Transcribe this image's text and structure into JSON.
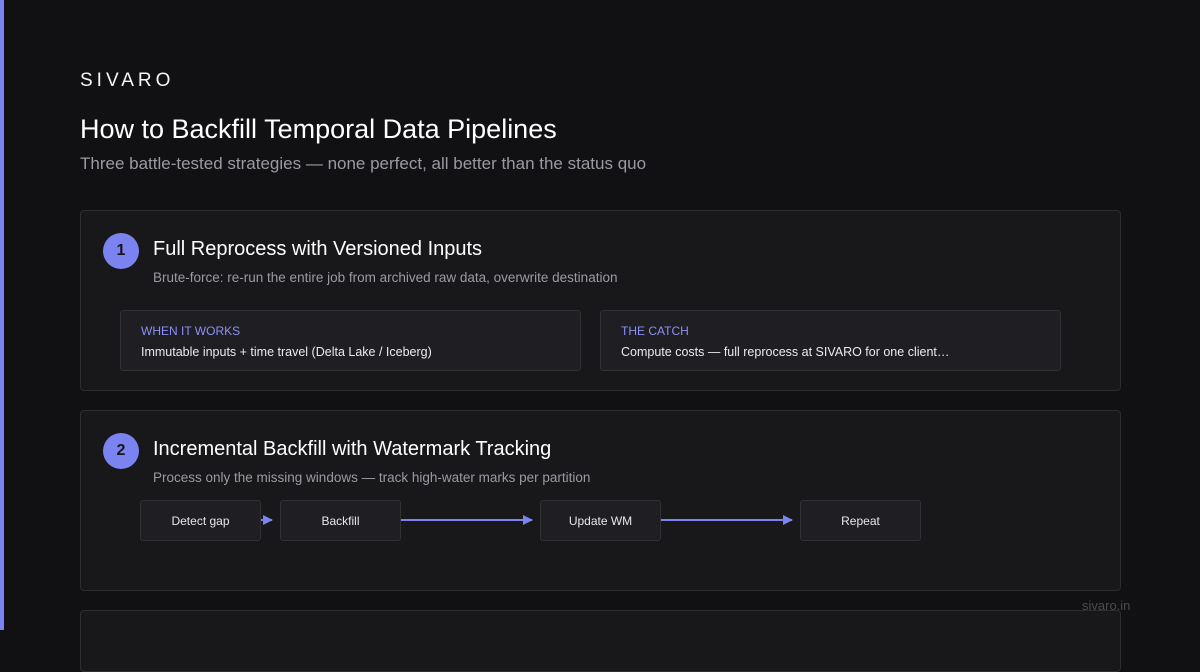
{
  "brand": "SIVARO",
  "title": "How to Backfill Temporal Data Pipelines",
  "subtitle": "Three battle-tested strategies — none perfect, all better than the status quo",
  "colors": {
    "accent": "#7b83f0",
    "background": "#111113",
    "card": "#18181b",
    "label": "#8b90f5"
  },
  "strategies": [
    {
      "number": "1",
      "title": "Full Reprocess with Versioned Inputs",
      "description": "Brute-force: re-run the entire job from archived raw data, overwrite destination",
      "when_label": "WHEN IT WORKS",
      "when_text": "Immutable inputs + time travel (Delta Lake / Iceberg)",
      "catch_label": "THE CATCH",
      "catch_text": "Compute costs — full reprocess at SIVARO for one client…"
    },
    {
      "number": "2",
      "title": "Incremental Backfill with Watermark Tracking",
      "description": "Process only the missing windows — track high-water marks per partition",
      "steps": [
        "Detect gap",
        "Backfill",
        "Update WM",
        "Repeat"
      ]
    }
  ],
  "footer_url": "sivaro.in"
}
